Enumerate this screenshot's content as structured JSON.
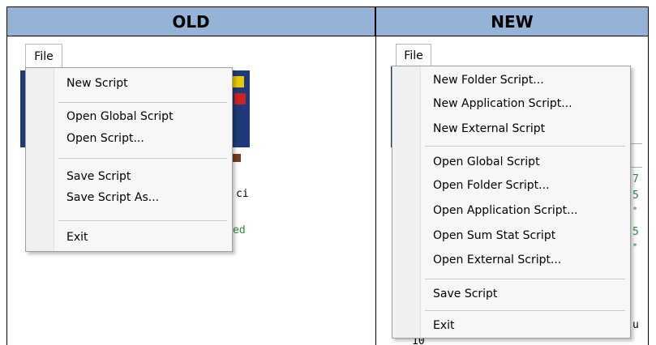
{
  "headers": {
    "old": "OLD",
    "new": "NEW"
  },
  "old": {
    "menu_title": "File",
    "items": [
      "New Script",
      "Open Global Script",
      "Open Script...",
      "Save Script",
      "Save Script As...",
      "Exit"
    ],
    "code_fragments": [
      "ci",
      "ed"
    ]
  },
  "new": {
    "menu_title": "File",
    "items": [
      "New Folder Script...",
      "New Application Script...",
      "New External Script",
      "Open Global Script",
      "Open Folder Script...",
      "Open Application Script...",
      "Open Sum Stat Script",
      "Open External Script...",
      "Save Script",
      "Exit"
    ],
    "code_fragments": [
      "7",
      "5",
      "*",
      "5",
      "*",
      "u",
      "10"
    ]
  },
  "colors": {
    "header_bg": "#95b3d7",
    "app_blue": "#1f3a7a",
    "code_green": "#2e8b3a"
  }
}
